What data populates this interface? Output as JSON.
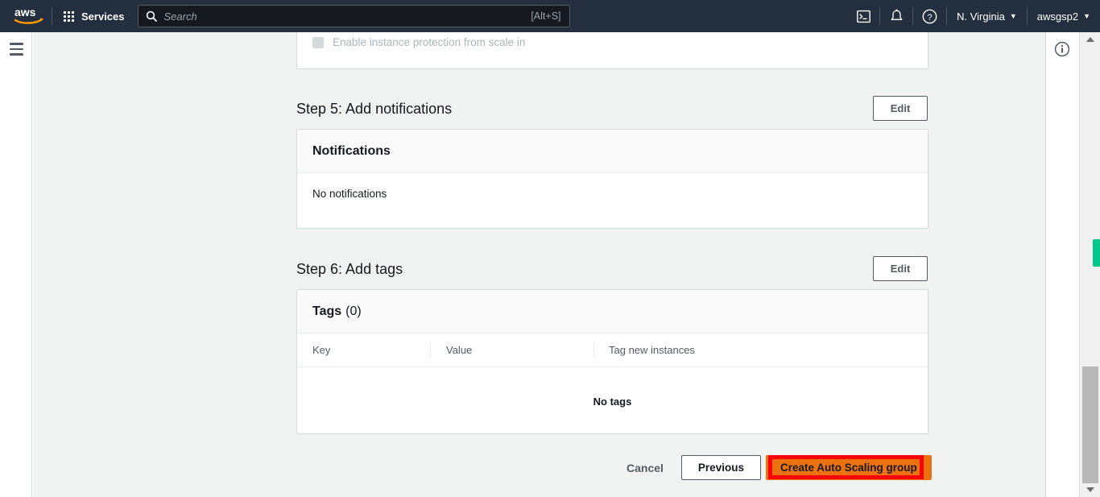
{
  "topnav": {
    "logo_alt": "aws",
    "services_label": "Services",
    "search": {
      "placeholder": "Search",
      "hint": "[Alt+S]",
      "value": ""
    },
    "cloudshell_icon": "cloudshell-icon",
    "notifications_icon": "bell-icon",
    "help_icon": "help-circle-icon",
    "region_label": "N. Virginia",
    "account_label": "awsgsp2",
    "caret": "▼"
  },
  "left_rail": {
    "menu_icon": "hamburger-menu-icon"
  },
  "right_rail": {
    "info_icon": "info-circle-icon"
  },
  "step4_tail": {
    "checkbox_label": "Enable instance protection from scale in",
    "checkbox_checked": false,
    "checkbox_disabled": true
  },
  "step5": {
    "heading": "Step 5: Add notifications",
    "edit_label": "Edit",
    "panel_title": "Notifications",
    "empty_text": "No notifications"
  },
  "step6": {
    "heading": "Step 6: Add tags",
    "edit_label": "Edit",
    "panel_title": "Tags",
    "panel_count": "(0)",
    "columns": [
      "Key",
      "Value",
      "Tag new instances"
    ],
    "rows": [],
    "empty_text": "No tags"
  },
  "footer": {
    "cancel_label": "Cancel",
    "previous_label": "Previous",
    "create_label": "Create Auto Scaling group"
  },
  "annotation": {
    "type": "red-rectangle-highlight",
    "color": "#ff0000"
  },
  "scrollbar": {
    "up_arrow": "scroll-up-arrow-icon",
    "down_arrow": "scroll-down-arrow-icon",
    "marker_color": "#00c88a"
  },
  "colors": {
    "nav_bg": "#232f3e",
    "page_bg": "#f1f3f3",
    "accent_orange": "#ec7211",
    "border": "#d5dbdb"
  }
}
